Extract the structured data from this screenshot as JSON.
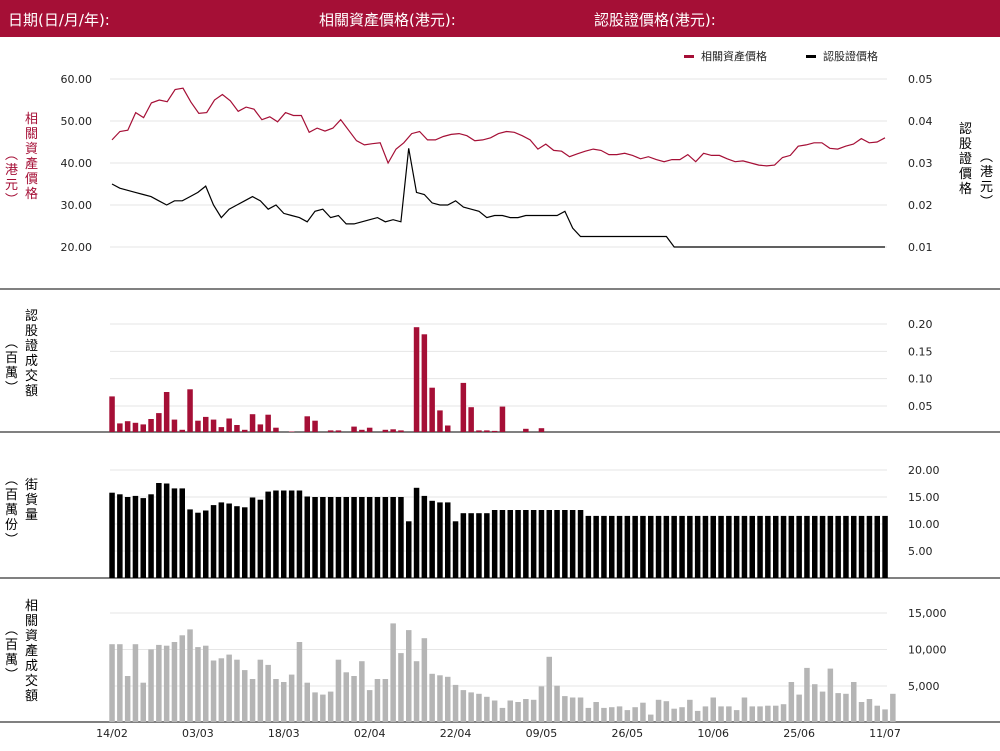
{
  "header": {
    "date_label": "日期(日/月/年):",
    "underlying_price_label": "相關資產價格(港元):",
    "warrant_price_label": "認股證價格(港元):"
  },
  "colors": {
    "brand": "#a50f36",
    "warrant": "#000000",
    "gray": "#b5b5b5"
  },
  "axis_titles": {
    "underlying_price": "相關資產價格",
    "underlying_price_unit": "(港元)",
    "warrant_price": "認股證價格",
    "warrant_price_unit": "(港元)",
    "warrant_turnover": "認股證成交額",
    "warrant_turnover_unit": "(百萬)",
    "street_qty": "街貨量",
    "street_qty_unit": "(百萬份)",
    "underlying_turnover": "相關資產成交額",
    "underlying_turnover_unit": "(百萬)"
  },
  "chart_data": [
    {
      "type": "line",
      "legend": [
        "相關資產價格",
        "認股證價格"
      ],
      "legend_position": "top-right",
      "yticks_left": [
        "60.00",
        "50.00",
        "40.00",
        "30.00",
        "20.00"
      ],
      "yticks_right": [
        "0.05",
        "0.04",
        "0.03",
        "0.02",
        "0.01"
      ],
      "ylim_left": [
        20,
        60
      ],
      "ylim_right": [
        0.01,
        0.05
      ],
      "series": [
        {
          "name": "相關資產價格",
          "axis": "left",
          "values": [
            45.5,
            47.5,
            47.8,
            52,
            50.8,
            54.3,
            55,
            54.6,
            57.5,
            57.8,
            54.5,
            51.8,
            52,
            55,
            56.3,
            54.8,
            52.3,
            53.3,
            52.8,
            50.3,
            51,
            49.8,
            52,
            51.3,
            51.3,
            47.3,
            48.3,
            47.6,
            48.3,
            50.3,
            47.8,
            45.3,
            44.3,
            44.6,
            44.8,
            40,
            43.3,
            44.8,
            47,
            47.5,
            45.5,
            45.5,
            46.3,
            46.8,
            47,
            46.5,
            45.3,
            45.5,
            46,
            47,
            47.5,
            47.3,
            46.5,
            45.5,
            43.3,
            44.5,
            43,
            42.8,
            41.5,
            42.2,
            42.8,
            43.3,
            43,
            42,
            42,
            42.3,
            41.8,
            41,
            41.5,
            40.8,
            40.3,
            40.8,
            40.8,
            42,
            40.3,
            42.3,
            41.8,
            41.8,
            41,
            40.3,
            40.5,
            40,
            39.5,
            39.3,
            39.5,
            41.3,
            41.8,
            44,
            44.3,
            44.8,
            44.8,
            43.5,
            43.3,
            44,
            44.5,
            45.8,
            44.8,
            45,
            46
          ]
        },
        {
          "name": "認股證價格",
          "axis": "right",
          "values": [
            0.025,
            0.024,
            0.0235,
            0.023,
            0.0225,
            0.022,
            0.021,
            0.02,
            0.021,
            0.021,
            0.022,
            0.023,
            0.0245,
            0.02,
            0.017,
            0.019,
            0.02,
            0.021,
            0.022,
            0.021,
            0.019,
            0.02,
            0.018,
            0.0175,
            0.017,
            0.016,
            0.0185,
            0.019,
            0.017,
            0.0175,
            0.0155,
            0.0155,
            0.016,
            0.0165,
            0.017,
            0.016,
            0.0165,
            0.016,
            0.0335,
            0.023,
            0.0225,
            0.0205,
            0.02,
            0.02,
            0.021,
            0.0195,
            0.019,
            0.0185,
            0.017,
            0.0175,
            0.0175,
            0.017,
            0.017,
            0.0175,
            0.0175,
            0.0175,
            0.0175,
            0.0175,
            0.0185,
            0.0145,
            0.0125,
            0.0125,
            0.0125,
            0.0125,
            0.0125,
            0.0125,
            0.0125,
            0.0125,
            0.0125,
            0.0125,
            0.0125,
            0.0125,
            0.01,
            0.01,
            0.01,
            0.01,
            0.01,
            0.01,
            0.01,
            0.01,
            0.01,
            0.01,
            0.01,
            0.01,
            0.01,
            0.01,
            0.01,
            0.01,
            0.01,
            0.01,
            0.01,
            0.01,
            0.01,
            0.01,
            0.01,
            0.01,
            0.01,
            0.01,
            0.01,
            0.01
          ]
        }
      ]
    },
    {
      "type": "bar",
      "series_name": "認股證成交額",
      "yticks_right": [
        "0.20",
        "0.15",
        "0.10",
        "0.05"
      ],
      "ylim": [
        0,
        0.2
      ],
      "values": [
        0.066,
        0.016,
        0.02,
        0.017,
        0.014,
        0.024,
        0.035,
        0.074,
        0.023,
        0.004,
        0.079,
        0.021,
        0.028,
        0.023,
        0.009,
        0.025,
        0.013,
        0.004,
        0.033,
        0.014,
        0.032,
        0.008,
        0,
        0.001,
        0,
        0.029,
        0.021,
        0,
        0.003,
        0.003,
        0,
        0.01,
        0.004,
        0.008,
        0,
        0.004,
        0.005,
        0.003,
        0,
        0.194,
        0.181,
        0.082,
        0.04,
        0.012,
        0,
        0.091,
        0.046,
        0.003,
        0.003,
        0.002,
        0.047,
        0,
        0,
        0.006,
        0,
        0.007,
        0,
        0,
        0,
        0,
        0,
        0,
        0,
        0.002,
        0,
        0.014,
        0,
        0,
        0.003,
        0,
        0,
        0,
        0,
        0,
        0,
        0,
        0,
        0,
        0,
        0,
        0,
        0,
        0,
        0,
        0,
        0,
        0,
        0,
        0,
        0,
        0,
        0,
        0,
        0,
        0,
        0,
        0,
        0,
        0,
        0
      ],
      "visible_count": 61
    },
    {
      "type": "bar",
      "series_name": "街貨量",
      "yticks_right": [
        "20.00",
        "15.00",
        "10.00",
        "5.00"
      ],
      "ylim": [
        0,
        20
      ],
      "values": [
        15.8,
        15.5,
        15,
        15.2,
        14.8,
        15.5,
        17.6,
        17.5,
        16.6,
        16.6,
        12.7,
        12.1,
        12.5,
        13.5,
        14,
        13.8,
        13.3,
        13.1,
        14.9,
        14.5,
        16,
        16.2,
        16.2,
        16.2,
        16.2,
        15.1,
        15,
        15,
        15,
        15,
        15,
        15,
        15,
        15,
        15,
        15,
        15,
        15,
        10.5,
        16.7,
        15.2,
        14.3,
        14,
        14,
        10.5,
        12,
        12,
        12,
        12,
        12.6,
        12.6,
        12.6,
        12.6,
        12.6,
        12.6,
        12.6,
        12.6,
        12.6,
        12.6,
        12.6,
        12.6,
        11.5,
        11.5,
        11.5,
        11.5,
        11.5,
        11.5,
        11.5,
        11.5,
        11.5,
        11.5,
        11.5,
        11.5,
        11.5,
        11.5,
        11.5,
        11.5,
        11.5,
        11.5,
        11.5,
        11.5,
        11.5,
        11.5,
        11.5,
        11.5,
        11.5,
        11.5,
        11.5,
        11.5,
        11.5,
        11.5,
        11.5,
        11.5,
        11.5,
        11.5,
        11.5,
        11.5,
        11.5,
        11.5,
        11.5
      ]
    },
    {
      "type": "bar",
      "series_name": "相關資產成交額",
      "yticks_right": [
        "15,000",
        "10,000",
        "5,000"
      ],
      "ylim": [
        0,
        17000
      ],
      "values": [
        10500,
        10500,
        6200,
        10500,
        5300,
        9800,
        10400,
        10300,
        10800,
        11700,
        12500,
        10100,
        10300,
        8300,
        8600,
        9100,
        8400,
        7000,
        5800,
        8400,
        7700,
        5800,
        5400,
        6400,
        10800,
        5300,
        4000,
        3700,
        4100,
        8400,
        6700,
        6200,
        8200,
        4300,
        5800,
        5800,
        13300,
        9300,
        12400,
        8200,
        11300,
        6500,
        6300,
        6100,
        5000,
        4300,
        4000,
        3800,
        3400,
        2900,
        1900,
        2900,
        2700,
        3100,
        3000,
        4800,
        8800,
        4900,
        3500,
        3300,
        3300,
        1900,
        2700,
        1900,
        2000,
        2100,
        1600,
        2000,
        2600,
        1000,
        3000,
        2800,
        1800,
        2000,
        3000,
        1500,
        2100,
        3300,
        2100,
        2100,
        1600,
        3300,
        2100,
        2100,
        2200,
        2200,
        2400,
        5400,
        3700,
        7300,
        5100,
        4100,
        7200,
        3900,
        3800,
        5400,
        2700,
        3100,
        2200,
        1700,
        3800
      ],
      "xlabels": [
        "14/02",
        "03/03",
        "18/03",
        "02/04",
        "22/04",
        "09/05",
        "26/05",
        "10/06",
        "25/06",
        "11/07"
      ]
    }
  ]
}
